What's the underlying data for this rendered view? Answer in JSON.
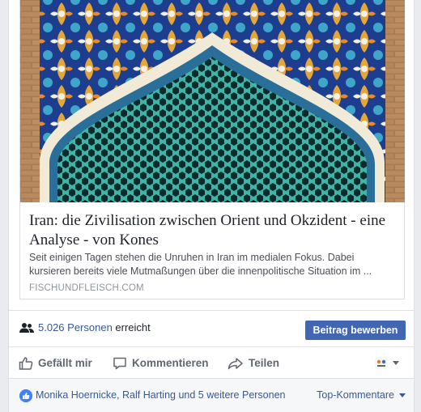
{
  "link_preview": {
    "title": "Iran: die Zivilisation zwischen Orient und Okzident - eine Analyse - von Kones",
    "description": "Seit einigen Tagen stehen die Unruhen in Iran im medialen Fokus. Dabei kursieren bereits viele Mutmaßungen über die innenpolitische Situation im ...",
    "domain": "FISCHUNDFLEISCH.COM",
    "image_icon": "persian-tile-archway-image"
  },
  "reach": {
    "count": "5.026 Personen",
    "suffix": "erreicht",
    "icon": "people-icon"
  },
  "boost_button": {
    "label": "Beitrag bewerben"
  },
  "actions": {
    "like": "Gefällt mir",
    "comment": "Kommentieren",
    "share": "Teilen",
    "reaction_picker_icon": "avatar-icon"
  },
  "social": {
    "likers": "Monika Hoernicke, Ralf Harting und 5 weitere Personen",
    "sort_label": "Top-Kommentare"
  },
  "colors": {
    "accent": "#4267b2",
    "link": "#365899",
    "like_badge": "#4080ff",
    "tile_teal": "#3fb5aa",
    "tile_blue": "#1d3d8f",
    "tile_gold": "#e3a637",
    "brick": "#a87b52"
  }
}
